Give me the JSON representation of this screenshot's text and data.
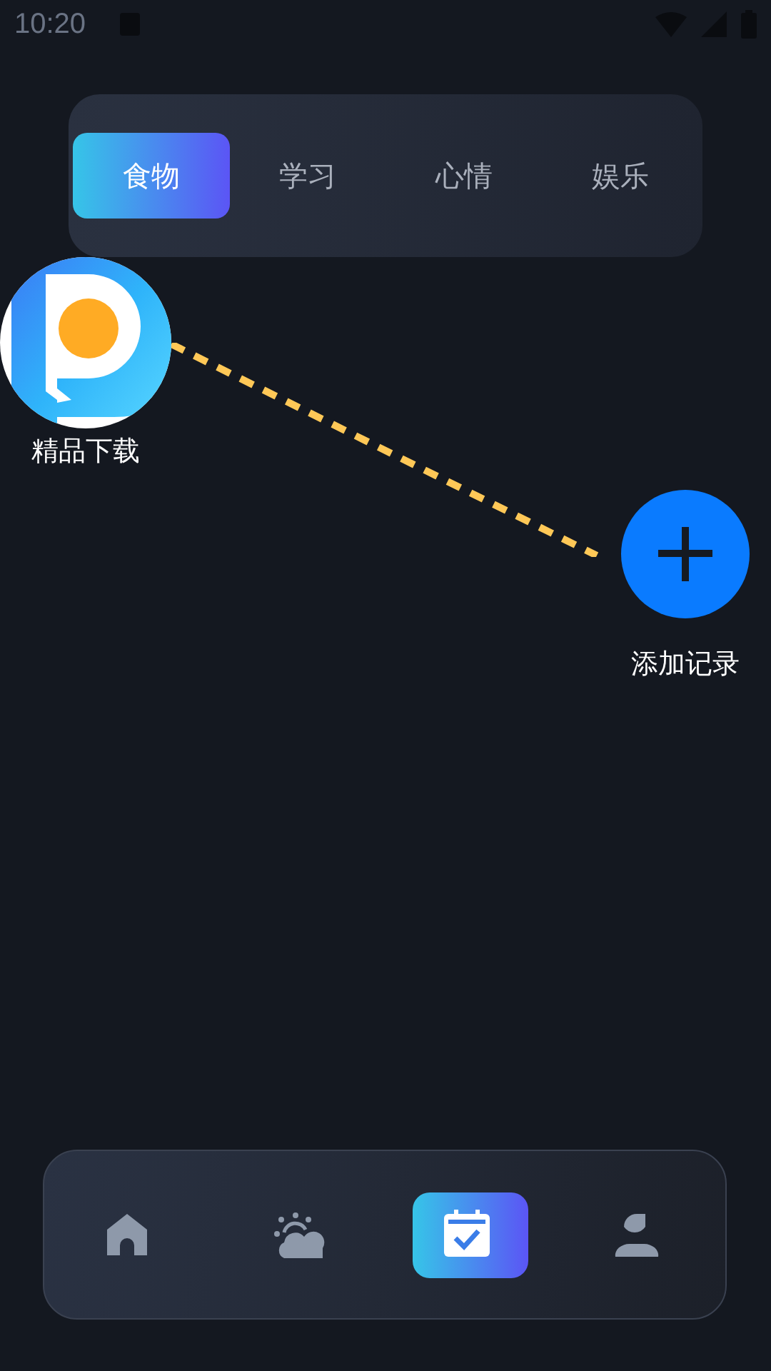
{
  "status_bar": {
    "time": "10:20"
  },
  "tabs": [
    {
      "label": "食物",
      "selected": true
    },
    {
      "label": "学习",
      "selected": false
    },
    {
      "label": "心情",
      "selected": false
    },
    {
      "label": "娱乐",
      "selected": false
    }
  ],
  "canvas": {
    "nodes": [
      {
        "kind": "app",
        "label": "精品下载"
      },
      {
        "kind": "add",
        "label": "添加记录"
      }
    ]
  },
  "bottom_nav": [
    {
      "kind": "home",
      "selected": false
    },
    {
      "kind": "weather",
      "selected": false
    },
    {
      "kind": "calendar",
      "selected": true
    },
    {
      "kind": "profile",
      "selected": false
    }
  ]
}
